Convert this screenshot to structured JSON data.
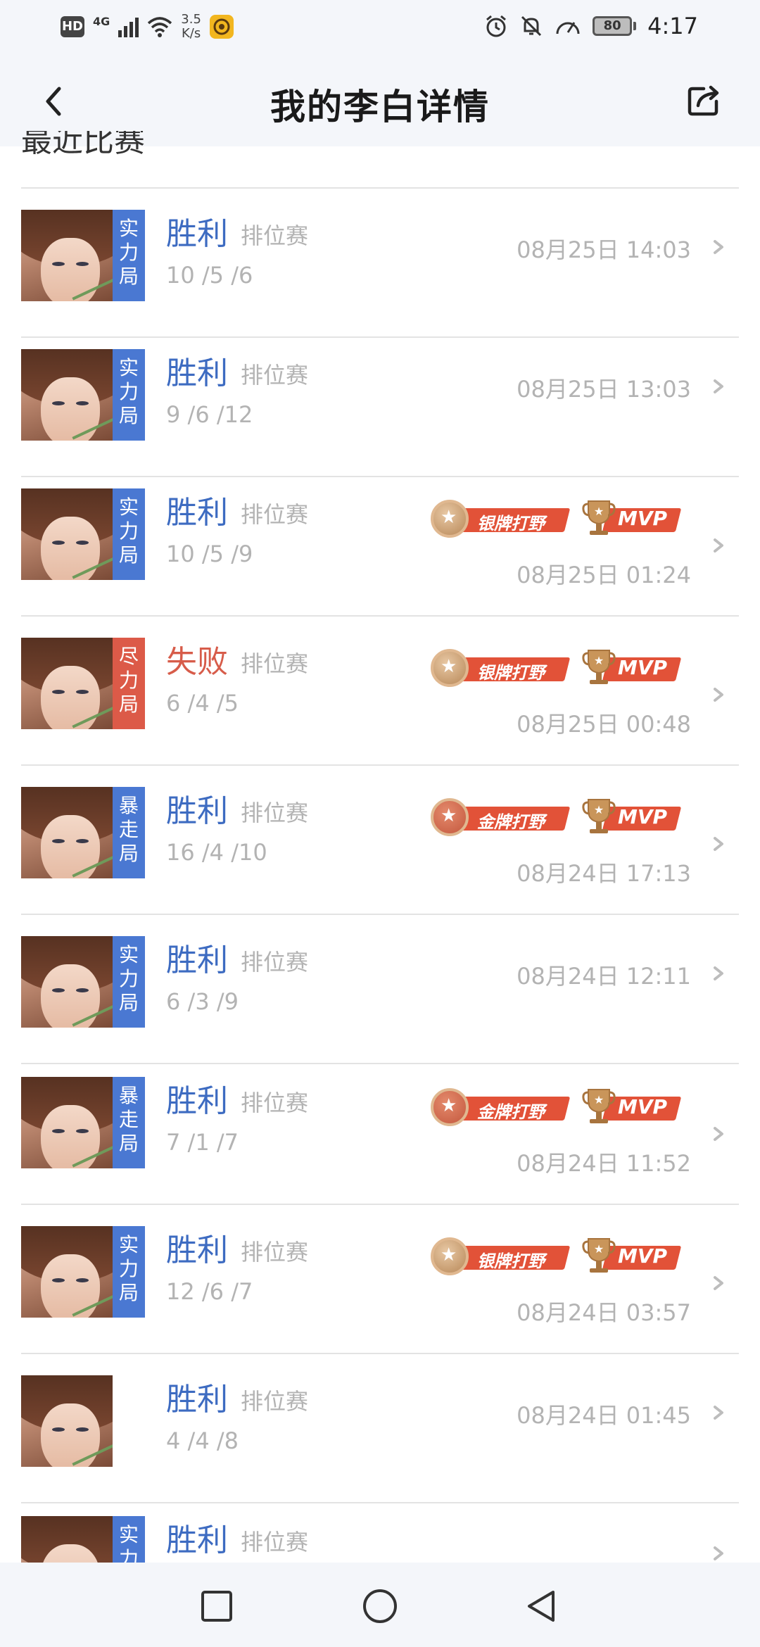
{
  "status_bar": {
    "hd": "HD",
    "network": "4G",
    "speed_value": "3.5",
    "speed_unit": "K/s",
    "battery": "80",
    "time": "4:17"
  },
  "header": {
    "title": "我的李白详情",
    "back_icon": "chevron-left-icon",
    "share_icon": "share-icon"
  },
  "section": {
    "heading": "最近比赛"
  },
  "colors": {
    "win": "#3d6bc1",
    "loss": "#d75c4a",
    "tag_blue": "#4a78d2",
    "tag_red": "#dc5a48",
    "muted": "#b3b3b3"
  },
  "matches": [
    {
      "tag": "实力局",
      "tag_color": "blue",
      "result": "胜利",
      "outcome": "win",
      "mode": "排位赛",
      "kda": "10 /5 /6",
      "time": "08月25日 14:03",
      "medal": "",
      "mvp": ""
    },
    {
      "tag": "实力局",
      "tag_color": "blue",
      "result": "胜利",
      "outcome": "win",
      "mode": "排位赛",
      "kda": "9 /6 /12",
      "time": "08月25日 13:03",
      "medal": "",
      "mvp": ""
    },
    {
      "tag": "实力局",
      "tag_color": "blue",
      "result": "胜利",
      "outcome": "win",
      "mode": "排位赛",
      "kda": "10 /5 /9",
      "time": "08月25日 01:24",
      "medal": "银牌打野",
      "medal_type": "silver",
      "mvp": "MVP"
    },
    {
      "tag": "尽力局",
      "tag_color": "red",
      "result": "失败",
      "outcome": "loss",
      "mode": "排位赛",
      "kda": "6 /4 /5",
      "time": "08月25日 00:48",
      "medal": "银牌打野",
      "medal_type": "silver",
      "mvp": "MVP"
    },
    {
      "tag": "暴走局",
      "tag_color": "blue",
      "result": "胜利",
      "outcome": "win",
      "mode": "排位赛",
      "kda": "16 /4 /10",
      "time": "08月24日 17:13",
      "medal": "金牌打野",
      "medal_type": "gold",
      "mvp": "MVP"
    },
    {
      "tag": "实力局",
      "tag_color": "blue",
      "result": "胜利",
      "outcome": "win",
      "mode": "排位赛",
      "kda": "6 /3 /9",
      "time": "08月24日 12:11",
      "medal": "",
      "mvp": ""
    },
    {
      "tag": "暴走局",
      "tag_color": "blue",
      "result": "胜利",
      "outcome": "win",
      "mode": "排位赛",
      "kda": "7 /1 /7",
      "time": "08月24日 11:52",
      "medal": "金牌打野",
      "medal_type": "gold",
      "mvp": "MVP"
    },
    {
      "tag": "实力局",
      "tag_color": "blue",
      "result": "胜利",
      "outcome": "win",
      "mode": "排位赛",
      "kda": "12 /6 /7",
      "time": "08月24日 03:57",
      "medal": "银牌打野",
      "medal_type": "silver",
      "mvp": "MVP"
    },
    {
      "tag": "",
      "tag_color": "",
      "result": "胜利",
      "outcome": "win",
      "mode": "排位赛",
      "kda": "4 /4 /8",
      "time": "08月24日 01:45",
      "medal": "",
      "mvp": ""
    },
    {
      "tag": "实力局",
      "tag_color": "blue",
      "result": "胜利",
      "outcome": "win",
      "mode": "排位赛",
      "kda": "",
      "time": "",
      "medal": "",
      "mvp": ""
    }
  ],
  "nav_bar": {
    "recent_icon": "square-recent-apps-icon",
    "home_icon": "circle-home-icon",
    "back_icon": "triangle-back-icon"
  }
}
